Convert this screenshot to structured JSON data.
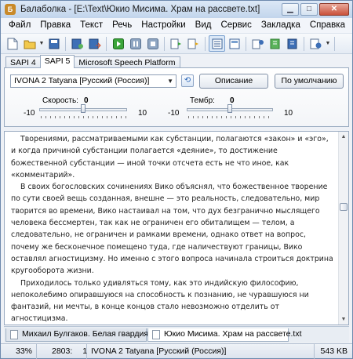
{
  "window": {
    "title": "Балаболка - [E:\\Text\\Юкио Мисима. Храм на рассвете.txt]",
    "app_icon": "balabolka-app-icon",
    "accent": "#c98a2a"
  },
  "menu": [
    "Файл",
    "Правка",
    "Текст",
    "Речь",
    "Настройки",
    "Вид",
    "Сервис",
    "Закладка",
    "Справка"
  ],
  "toolbar": {
    "icons": [
      "new-document-icon",
      "open-folder-icon",
      "save-icon",
      "save-audio-icon",
      "export-icon",
      "play-icon",
      "pause-icon",
      "stop-icon",
      "read-clipboard-icon",
      "read-file-icon",
      "text-panel-icon",
      "voice-panel-icon",
      "speech-settings-icon",
      "dictionary-icon",
      "dictionary-edit-icon",
      "audio-file-icon"
    ]
  },
  "engine_tabs": [
    "SAPI 4",
    "SAPI 5",
    "Microsoft Speech Platform"
  ],
  "engine_tab_selected": "SAPI 5",
  "voice": {
    "selected": "IVONA 2 Tatyana [Русский (Россия)]",
    "describe_label": "Описание",
    "default_label": "По умолчанию"
  },
  "rate": {
    "label": "Скорость:",
    "value": "0",
    "min": "-10",
    "max": "10",
    "level": 0.5
  },
  "pitch": {
    "label": "Тембр:",
    "value": "0",
    "min": "-10",
    "max": "10",
    "level": 0.5
  },
  "editor": {
    "paragraphs": [
      "Творениями, рассматриваемыми как субстанции, полагаются «закон» и «эго», и когда причиной субстанции полагается «деяние», то достижение божественной субстанции — иной точки отсчета есть не что иное, как «комментарий».",
      "В своих богословских сочинениях Вико объяснял, что божественное творение по сути своей вещь созданная, внешне — это реальность, следовательно, мир творится во времени, Вико настаивал на том, что дух безгранично мыслящего человека бессмертен, так как не ограничен его обиталищем — телом, а следовательно, не ограничен и рамками времени, однако ответ на вопрос, почему же бесконечное помещено туда, где наличествуют границы, Вико оставлял агностицизму. Но именно с этого вопроса начинала строиться доктрина кругооборота жизни.",
      "Приходилось только удивляться тому, как это индийскую философию, непоколебимо опиравшуюся на способность к познанию, не чуравшуюся ни фантазий, ни мечты, в конце концов стало невозможно отделить от агностицизма."
    ],
    "scroll_position": 0.37
  },
  "documents": [
    {
      "name": "Михаил Булгаков. Белая гвардия.txt",
      "active": false
    },
    {
      "name": "Юкио Мисима. Храм на рассвете.txt",
      "active": true
    }
  ],
  "status": {
    "zoom": "33%",
    "line": "2803:",
    "column": "1",
    "voice": "IVONA 2 Tatyana [Русский (Россия)]",
    "size": "543 KB"
  }
}
